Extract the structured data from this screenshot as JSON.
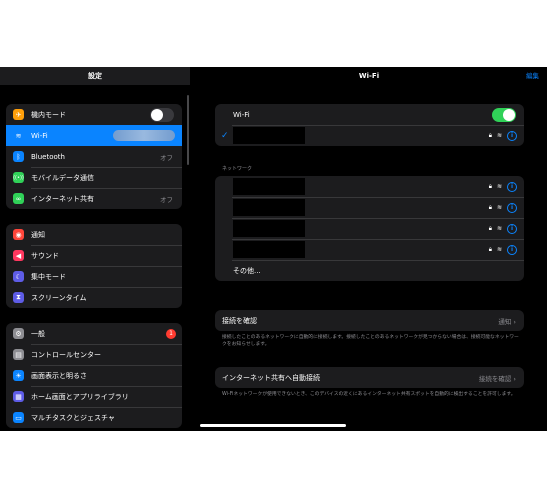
{
  "sidebar": {
    "title": "設定",
    "group1": [
      {
        "label": "機内モード",
        "icon": "airplane-icon",
        "color": "#ff9f0a",
        "glyph": "✈",
        "toggle": false
      },
      {
        "label": "Wi-Fi",
        "icon": "wifi-icon",
        "color": "#0a84ff",
        "glyph": "≋",
        "value": "",
        "selected": true
      },
      {
        "label": "Bluetooth",
        "icon": "bluetooth-icon",
        "color": "#0a84ff",
        "glyph": "ᛒ",
        "value": "オフ"
      },
      {
        "label": "モバイルデータ通信",
        "icon": "cellular-icon",
        "color": "#30d158",
        "glyph": "((•))",
        "value": ""
      },
      {
        "label": "インターネット共有",
        "icon": "hotspot-icon",
        "color": "#30d158",
        "glyph": "∞",
        "value": "オフ"
      }
    ],
    "group2": [
      {
        "label": "通知",
        "icon": "notifications-icon",
        "color": "#ff453a",
        "glyph": "◉"
      },
      {
        "label": "サウンド",
        "icon": "sound-icon",
        "color": "#ff375f",
        "glyph": "◀"
      },
      {
        "label": "集中モード",
        "icon": "focus-moon-icon",
        "color": "#5e5ce6",
        "glyph": "☾"
      },
      {
        "label": "スクリーンタイム",
        "icon": "screen-time-icon",
        "color": "#5e5ce6",
        "glyph": "⧗"
      }
    ],
    "group3": [
      {
        "label": "一般",
        "icon": "general-gear-icon",
        "color": "#8e8e93",
        "glyph": "⚙",
        "badge": "1"
      },
      {
        "label": "コントロールセンター",
        "icon": "control-center-icon",
        "color": "#8e8e93",
        "glyph": "▤"
      },
      {
        "label": "画面表示と明るさ",
        "icon": "brightness-icon",
        "color": "#0a84ff",
        "glyph": "☀"
      },
      {
        "label": "ホーム画面とアプリライブラリ",
        "icon": "home-screen-icon",
        "color": "#5e5ce6",
        "glyph": "▦"
      },
      {
        "label": "マルチタスクとジェスチャ",
        "icon": "multitasking-icon",
        "color": "#0a84ff",
        "glyph": "▭"
      }
    ]
  },
  "main": {
    "title": "Wi-Fi",
    "edit_label": "編集",
    "wifi_label": "Wi-Fi",
    "wifi_on": true,
    "networks_header": "ネットワーク",
    "other_label": "その他...",
    "ask_join": {
      "label": "接続を確認",
      "value": "通知",
      "footnote": "接続したことのあるネットワークに自動的に接続します。接続したことのあるネットワークが見つからない場合は、接続可能なネットワークをお知らせします。"
    },
    "auto_hotspot": {
      "label": "インターネット共有へ自動接続",
      "value": "接続を確認",
      "footnote": "Wi-Fiネットワークが使用できないとき、このデバイスの近くにあるインターネット共有スポットを自動的に検出することを許可します。"
    }
  }
}
